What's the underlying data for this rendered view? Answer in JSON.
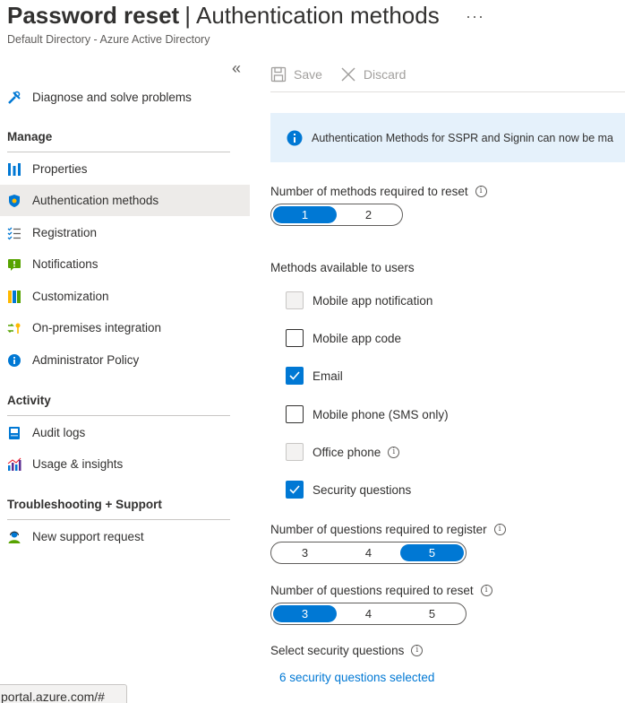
{
  "header": {
    "title_main": "Password reset",
    "title_separator": "|",
    "title_sub": "Authentication methods",
    "more_label": "···",
    "subtitle": "Default Directory - Azure Active Directory"
  },
  "sidebar": {
    "collapse_label": "«",
    "top_item": {
      "label": "Diagnose and solve problems",
      "icon": "wrench-icon"
    },
    "sections": [
      {
        "title": "Manage",
        "items": [
          {
            "label": "Properties",
            "icon": "properties-icon",
            "active": false
          },
          {
            "label": "Authentication methods",
            "icon": "shield-icon",
            "active": true
          },
          {
            "label": "Registration",
            "icon": "checklist-icon",
            "active": false
          },
          {
            "label": "Notifications",
            "icon": "notification-icon",
            "active": false
          },
          {
            "label": "Customization",
            "icon": "customization-icon",
            "active": false
          },
          {
            "label": "On-premises integration",
            "icon": "sync-key-icon",
            "active": false
          },
          {
            "label": "Administrator Policy",
            "icon": "info-icon",
            "active": false
          }
        ]
      },
      {
        "title": "Activity",
        "items": [
          {
            "label": "Audit logs",
            "icon": "audit-log-icon"
          },
          {
            "label": "Usage & insights",
            "icon": "bar-chart-icon"
          }
        ]
      },
      {
        "title": "Troubleshooting + Support",
        "items": [
          {
            "label": "New support request",
            "icon": "support-person-icon"
          }
        ]
      }
    ]
  },
  "toolbar": {
    "save_label": "Save",
    "discard_label": "Discard"
  },
  "banner": {
    "text": "Authentication Methods for SSPR and Signin can now be ma"
  },
  "methods_required": {
    "label": "Number of methods required to reset",
    "options": [
      "1",
      "2"
    ],
    "selected": "1"
  },
  "methods_available": {
    "label": "Methods available to users",
    "items": [
      {
        "label": "Mobile app notification",
        "checked": false,
        "disabled": true,
        "info": false
      },
      {
        "label": "Mobile app code",
        "checked": false,
        "disabled": false,
        "info": false
      },
      {
        "label": "Email",
        "checked": true,
        "disabled": false,
        "info": false
      },
      {
        "label": "Mobile phone (SMS only)",
        "checked": false,
        "disabled": false,
        "info": false
      },
      {
        "label": "Office phone",
        "checked": false,
        "disabled": true,
        "info": true
      },
      {
        "label": "Security questions",
        "checked": true,
        "disabled": false,
        "info": false
      }
    ]
  },
  "questions_register": {
    "label": "Number of questions required to register",
    "options": [
      "3",
      "4",
      "5"
    ],
    "selected": "5"
  },
  "questions_reset": {
    "label": "Number of questions required to reset",
    "options": [
      "3",
      "4",
      "5"
    ],
    "selected": "3"
  },
  "select_questions": {
    "label": "Select security questions",
    "link": "6 security questions selected"
  },
  "status_url": "portal.azure.com/#",
  "colors": {
    "accent": "#0078d4",
    "active_nav": "#edebe9",
    "banner_bg": "#e5f1fb"
  }
}
